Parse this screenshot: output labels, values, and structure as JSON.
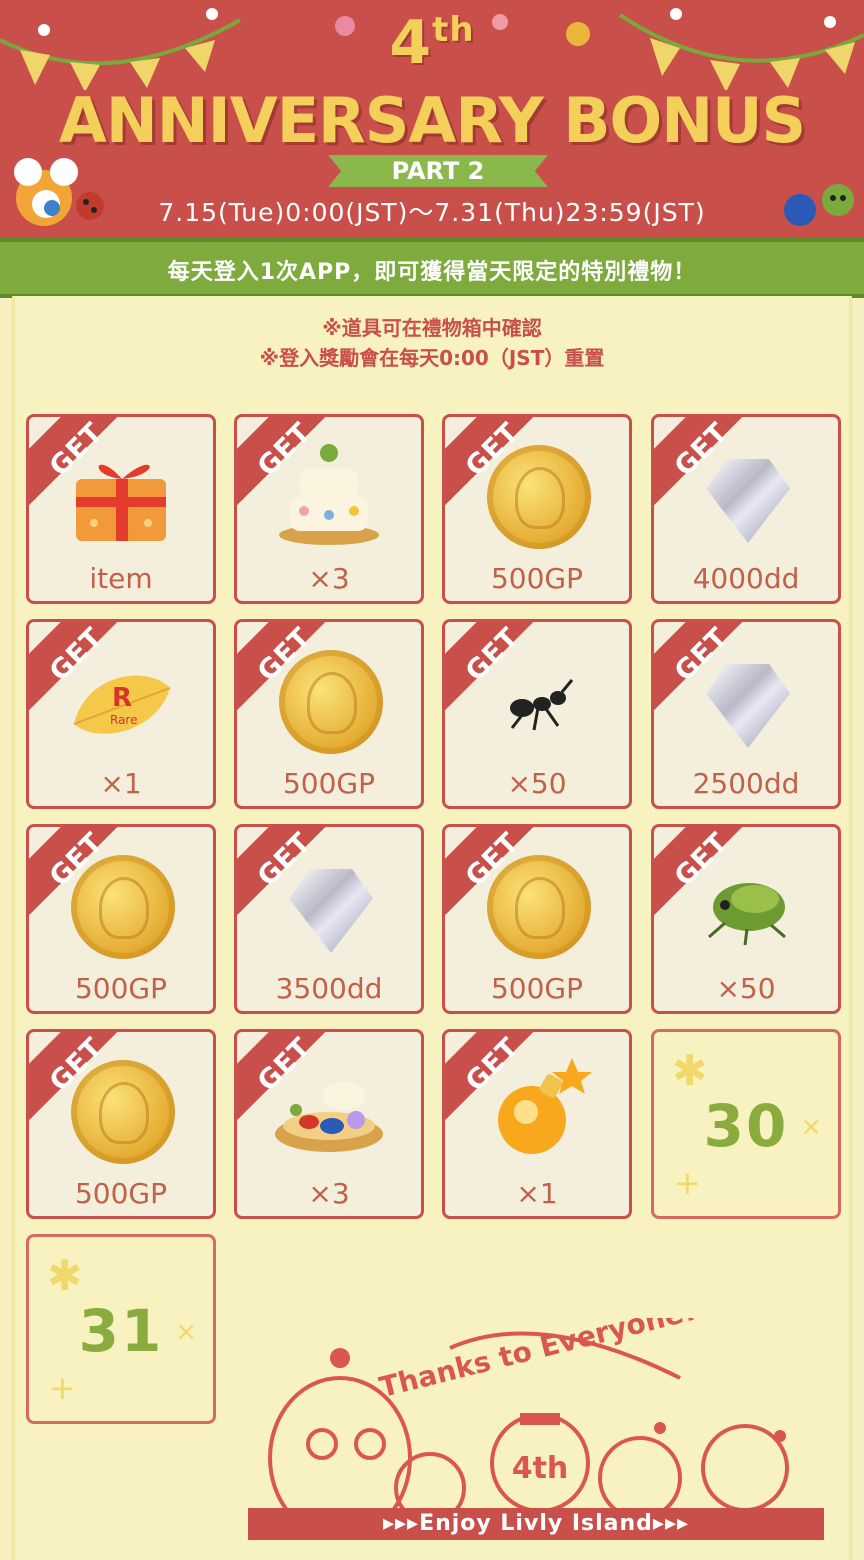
{
  "header": {
    "title_number": "4",
    "title_suffix": "th",
    "title_main": "ANNIVERSARY BONUS",
    "part": "PART 2",
    "dates": "7.15(Tue)0:00(JST)～7.31(Thu)23:59(JST)"
  },
  "banner": {
    "text": "每天登入1次APP，即可獲得當天限定的特別禮物！"
  },
  "notes": [
    "※道具可在禮物箱中確認",
    "※登入獎勵會在每天0:00（JST）重置"
  ],
  "get_label": "GET",
  "days": [
    {
      "label": "item",
      "icon": "gift-box-icon"
    },
    {
      "label": "×3",
      "icon": "cake-icon"
    },
    {
      "label": "500GP",
      "icon": "gold-coin-icon"
    },
    {
      "label": "4000dd",
      "icon": "diamond-icon"
    },
    {
      "label": "×1",
      "icon": "rare-leaf-icon"
    },
    {
      "label": "500GP",
      "icon": "gold-coin-icon"
    },
    {
      "label": "×50",
      "icon": "ant-icon"
    },
    {
      "label": "2500dd",
      "icon": "diamond-icon"
    },
    {
      "label": "500GP",
      "icon": "gold-coin-icon"
    },
    {
      "label": "3500dd",
      "icon": "diamond-icon"
    },
    {
      "label": "500GP",
      "icon": "gold-coin-icon"
    },
    {
      "label": "×50",
      "icon": "cicada-icon"
    },
    {
      "label": "500GP",
      "icon": "gold-coin-icon"
    },
    {
      "label": "×3",
      "icon": "tart-icon"
    },
    {
      "label": "×1",
      "icon": "potion-icon"
    }
  ],
  "upcoming": [
    {
      "day": "30",
      "mark_x": "×"
    },
    {
      "day": "31",
      "mark_x": "×"
    }
  ],
  "footer": {
    "thanks": "Thanks to Everyone!",
    "badge": "4th",
    "enjoy": "▸▸▸Enjoy Livly Island▸▸▸"
  },
  "colors": {
    "header_red": "#c9504a",
    "title_yellow": "#f4d05a",
    "banner_green": "#7fab3e",
    "panel_cream": "#f7f2bf",
    "day_green": "#8aac3e"
  }
}
